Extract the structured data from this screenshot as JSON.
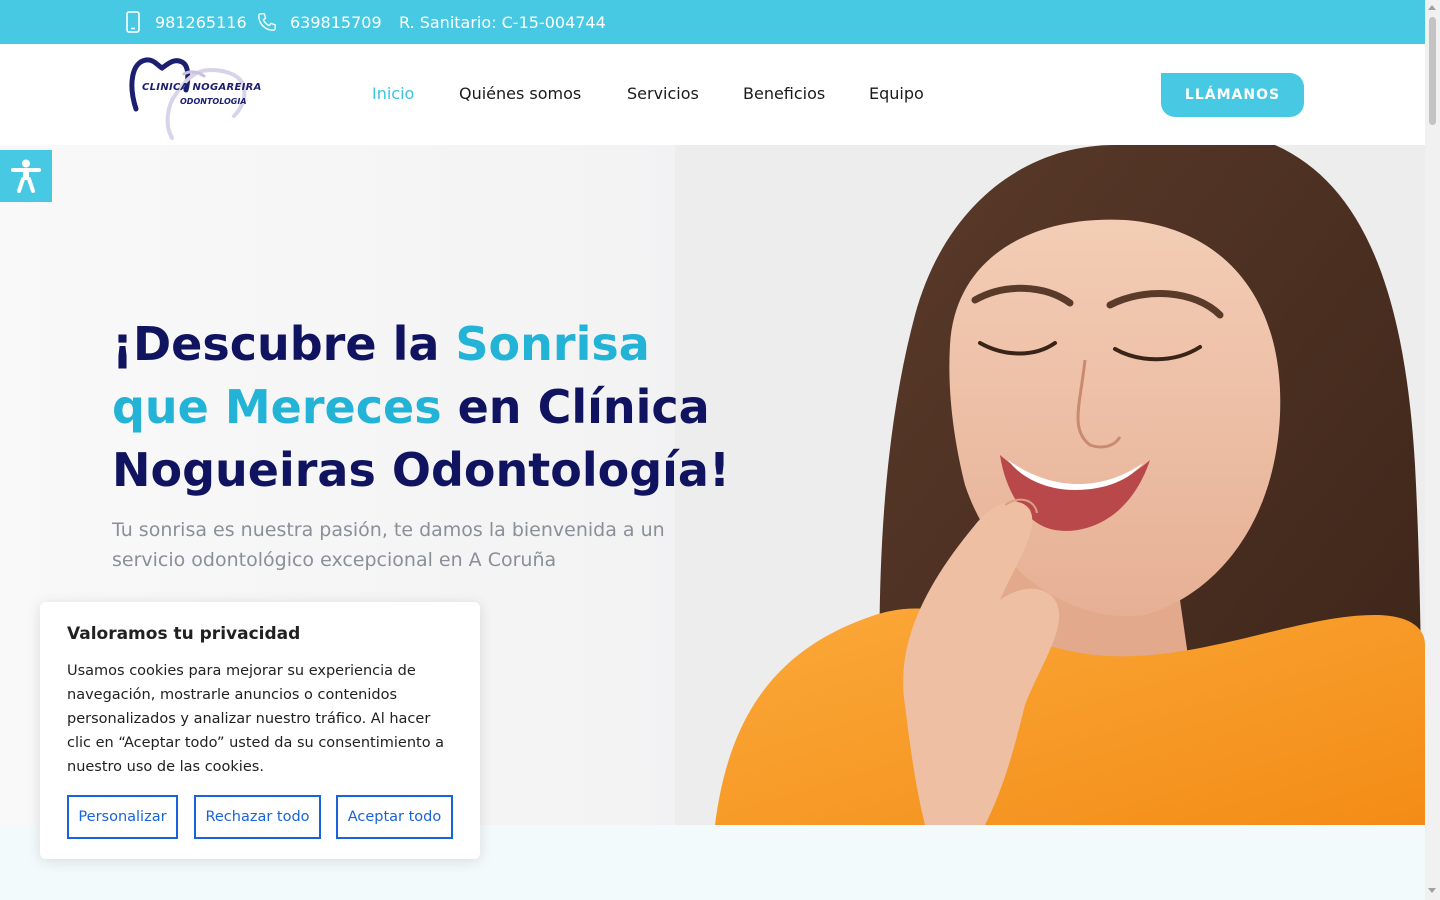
{
  "topbar": {
    "mobile_phone": "981265116",
    "landline_phone": "639815709",
    "registry": "R. Sanitario: C-15-004744",
    "color": "#48c9e3"
  },
  "logo": {
    "line1": "CLINICA NOGAREIRA",
    "line2": "ODONTOLOGIA"
  },
  "nav": {
    "items": [
      "Inicio",
      "Quiénes somos",
      "Servicios",
      "Beneficios",
      "Equipo"
    ],
    "active": "Inicio",
    "cta_label": "LLÁMANOS"
  },
  "hero": {
    "title_part1": "¡Descubre la ",
    "title_highlight": "Sonrisa que Mereces",
    "title_part2": " en Clínica Nogueiras Odontología!",
    "subtitle": "Tu sonrisa es nuestra pasión, te damos la bienvenida a un servicio odontológico excepcional en A Coruña",
    "title_color": "#10135f",
    "highlight_color": "#22b3d6"
  },
  "accessibility": {
    "icon": "accessibility-icon"
  },
  "cookie_banner": {
    "title": "Valoramos tu privacidad",
    "text": "Usamos cookies para mejorar su experiencia de navegación, mostrarle anuncios o contenidos personalizados y analizar nuestro tráfico. Al hacer clic en “Aceptar todo” usted da su consentimiento a nuestro uso de las cookies.",
    "customize_label": "Personalizar",
    "reject_label": "Rechazar todo",
    "accept_label": "Aceptar todo",
    "button_color": "#1863dc"
  }
}
